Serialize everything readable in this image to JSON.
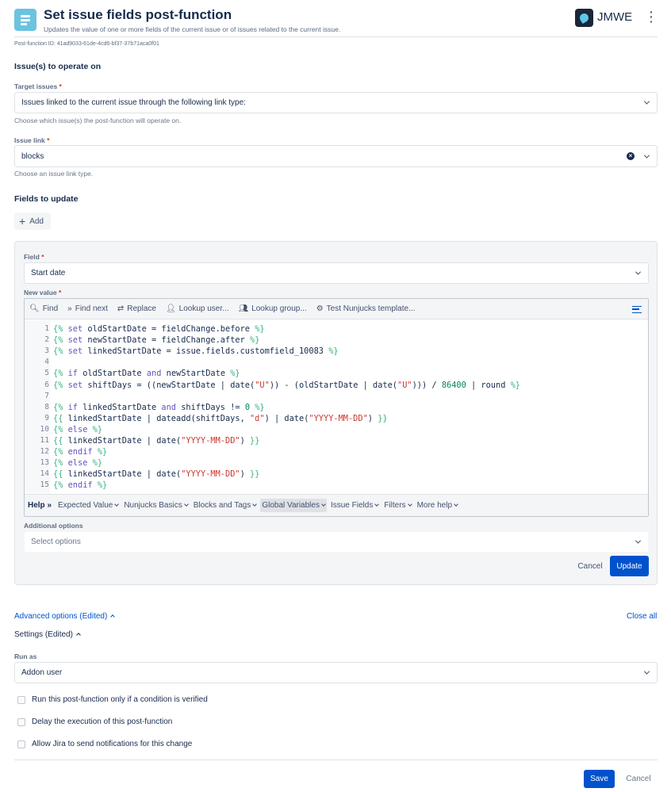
{
  "header": {
    "title": "Set issue fields post-function",
    "subtitle": "Updates the value of one or more fields of the current issue or of issues related to the current issue.",
    "brand": "JMWE",
    "post_function_id": "Post-function ID: 41ad9033-61de-4cd6-bf37-37b71aca0f01"
  },
  "issues_section": {
    "title": "Issue(s) to operate on",
    "target_label": "Target issues",
    "target_value": "Issues linked to the current issue through the following link type:",
    "target_helper": "Choose which issue(s) the post-function will operate on.",
    "link_label": "Issue link",
    "link_value": "blocks",
    "link_helper": "Choose an issue link type."
  },
  "fields_section": {
    "title": "Fields to update",
    "add_label": "Add"
  },
  "field_panel": {
    "field_label": "Field",
    "field_value": "Start date",
    "new_value_label": "New value",
    "additional_options_label": "Additional options",
    "additional_options_placeholder": "Select options",
    "cancel_label": "Cancel",
    "update_label": "Update"
  },
  "editor_toolbar": {
    "find": "Find",
    "find_next": "Find next",
    "replace": "Replace",
    "lookup_user": "Lookup user...",
    "lookup_group": "Lookup group...",
    "test_template": "Test Nunjucks template..."
  },
  "code_lines": [
    {
      "n": "1",
      "text": "{% set oldStartDate = fieldChange.before %}"
    },
    {
      "n": "2",
      "text": "{% set newStartDate = fieldChange.after %}"
    },
    {
      "n": "3",
      "text": "{% set linkedStartDate = issue.fields.customfield_10083 %}"
    },
    {
      "n": "4",
      "text": ""
    },
    {
      "n": "5",
      "text": "{% if oldStartDate and newStartDate %}"
    },
    {
      "n": "6",
      "text": "{% set shiftDays = ((newStartDate | date(\"U\")) - (oldStartDate | date(\"U\"))) / 86400 | round %}"
    },
    {
      "n": "7",
      "text": ""
    },
    {
      "n": "8",
      "text": "{% if linkedStartDate and shiftDays != 0 %}"
    },
    {
      "n": "9",
      "text": "{{ linkedStartDate | dateadd(shiftDays, \"d\") | date(\"YYYY-MM-DD\") }}"
    },
    {
      "n": "10",
      "text": "{% else %}"
    },
    {
      "n": "11",
      "text": "{{ linkedStartDate | date(\"YYYY-MM-DD\") }}"
    },
    {
      "n": "12",
      "text": "{% endif %}"
    },
    {
      "n": "13",
      "text": "{% else %}"
    },
    {
      "n": "14",
      "text": "{{ linkedStartDate | date(\"YYYY-MM-DD\") }}"
    },
    {
      "n": "15",
      "text": "{% endif %}"
    }
  ],
  "help_bar": {
    "help": "Help",
    "items": [
      "Expected Value",
      "Nunjucks Basics",
      "Blocks and Tags",
      "Global Variables",
      "Issue Fields",
      "Filters",
      "More help"
    ]
  },
  "advanced": {
    "advanced_label": "Advanced options (Edited)",
    "close_all": "Close all",
    "settings_label": "Settings (Edited)",
    "run_as_label": "Run as",
    "run_as_value": "Addon user",
    "checkbox_condition": "Run this post-function only if a condition is verified",
    "checkbox_delay": "Delay the execution of this post-function",
    "checkbox_notify": "Allow Jira to send notifications for this change"
  },
  "footer": {
    "save": "Save",
    "cancel": "Cancel"
  },
  "colors": {
    "primary": "#0052cc",
    "header_icon": "#6cc3e0",
    "required": "#de350b"
  }
}
